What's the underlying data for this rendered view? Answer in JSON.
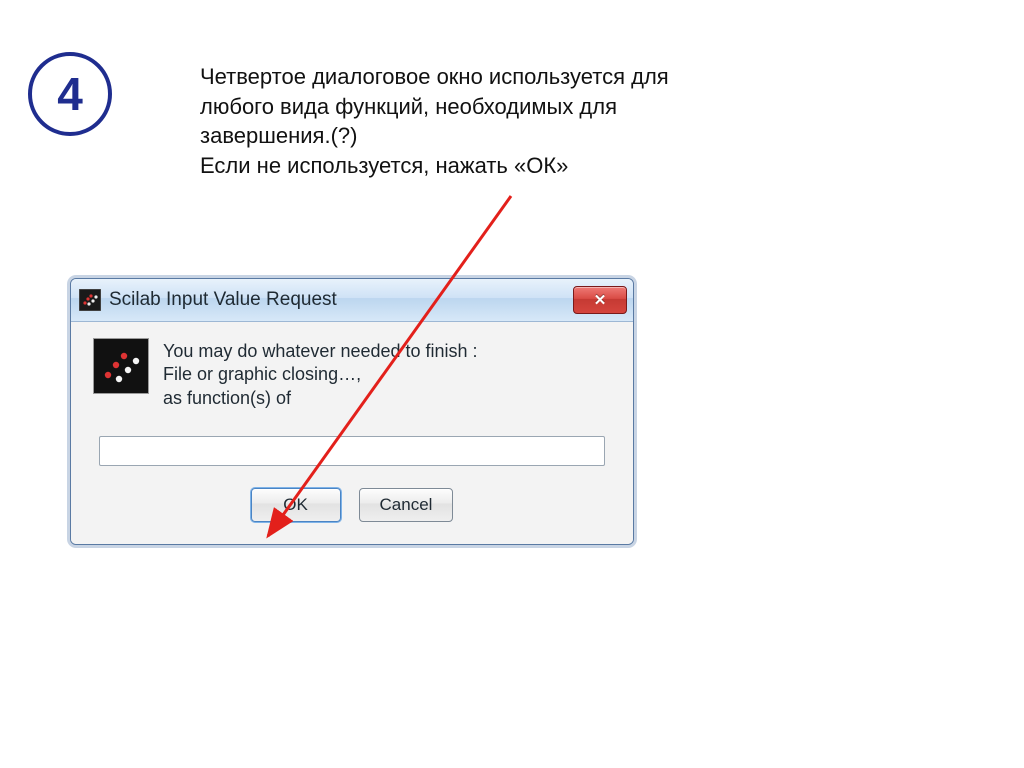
{
  "step": {
    "number": "4"
  },
  "explanation": {
    "line1": "Четвертое диалоговое окно используется для",
    "line2": "любого вида функций, необходимых для",
    "line3": "завершения.(?)",
    "line4": "Если не используется, нажать «ОК»"
  },
  "dialog": {
    "title": "Scilab Input Value Request",
    "close_label": "✕",
    "message": {
      "line1": "You may do whatever needed to finish :",
      "line2": "File or graphic closing…,",
      "line3": "as function(s) of"
    },
    "input_value": "",
    "buttons": {
      "ok": "OK",
      "cancel": "Cancel"
    }
  },
  "colors": {
    "accent": "#1f2d8f",
    "arrow": "#e3201b"
  }
}
